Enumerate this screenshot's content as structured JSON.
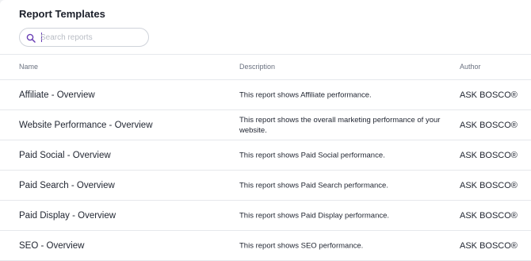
{
  "page": {
    "title": "Report Templates"
  },
  "search": {
    "placeholder": "Search reports",
    "value": ""
  },
  "table": {
    "columns": {
      "name": "Name",
      "description": "Description",
      "author": "Author"
    },
    "rows": [
      {
        "name": "Affiliate - Overview",
        "description": "This report shows Affiliate performance.",
        "author": "ASK BOSCO®"
      },
      {
        "name": "Website Performance - Overview",
        "description": "This report shows the overall marketing performance of your website.",
        "author": "ASK BOSCO®"
      },
      {
        "name": "Paid Social - Overview",
        "description": "This report shows Paid Social performance.",
        "author": "ASK BOSCO®"
      },
      {
        "name": "Paid Search - Overview",
        "description": "This report shows Paid Search performance.",
        "author": "ASK BOSCO®"
      },
      {
        "name": "Paid Display - Overview",
        "description": "This report shows Paid Display performance.",
        "author": "ASK BOSCO®"
      },
      {
        "name": "SEO - Overview",
        "description": "This report shows SEO performance.",
        "author": "ASK BOSCO®"
      }
    ]
  },
  "colors": {
    "accent": "#6a3fb5",
    "border": "#e6e8ec",
    "header_text": "#6b7280"
  },
  "icons": {
    "search": "search-icon"
  }
}
